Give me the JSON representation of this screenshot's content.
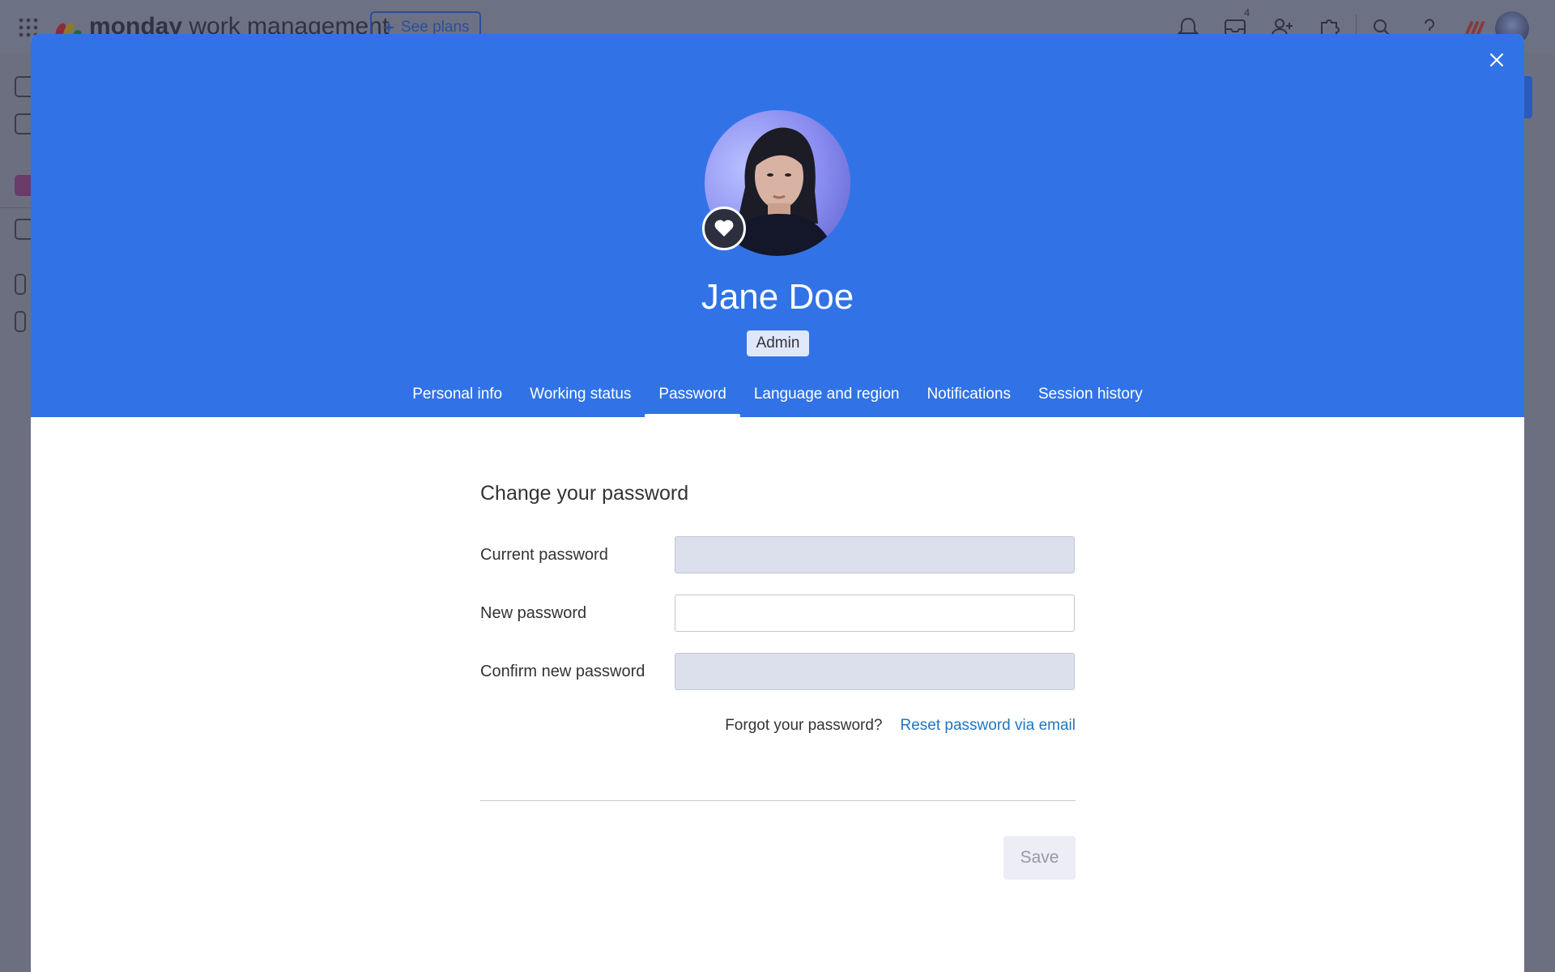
{
  "app": {
    "brand_bold": "monday",
    "brand_rest": " work management",
    "see_plans_label": "See plans",
    "inbox_badge": "4"
  },
  "modal": {
    "user_name": "Jane Doe",
    "role": "Admin",
    "tabs": [
      {
        "label": "Personal info",
        "active": false
      },
      {
        "label": "Working status",
        "active": false
      },
      {
        "label": "Password",
        "active": true
      },
      {
        "label": "Language and region",
        "active": false
      },
      {
        "label": "Notifications",
        "active": false
      },
      {
        "label": "Session history",
        "active": false
      }
    ]
  },
  "password_form": {
    "title": "Change your password",
    "current_label": "Current password",
    "current_value": "",
    "new_label": "New password",
    "new_value": "",
    "confirm_label": "Confirm new password",
    "confirm_value": "",
    "forgot_text": "Forgot your password?",
    "reset_link": "Reset password via email",
    "save_label": "Save"
  },
  "colors": {
    "header_blue": "#3173e6",
    "link_blue": "#1f76c2",
    "overlay": "#6b6f80"
  }
}
